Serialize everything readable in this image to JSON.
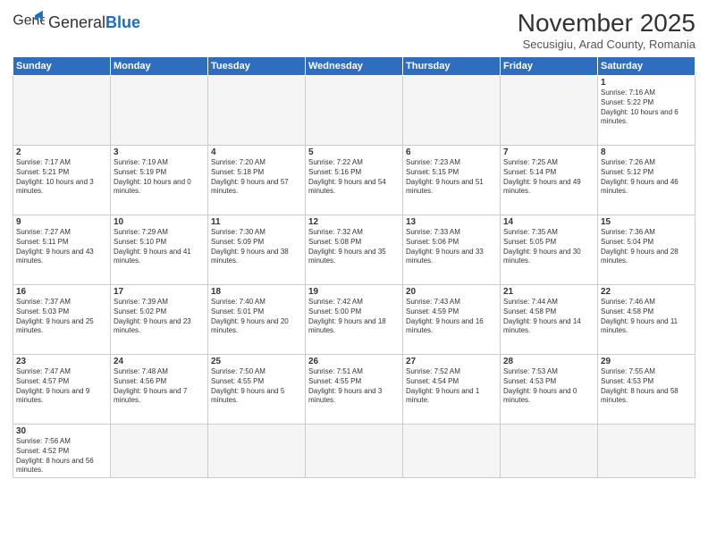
{
  "header": {
    "logo_general": "General",
    "logo_blue": "Blue",
    "month": "November 2025",
    "location": "Secusigiu, Arad County, Romania"
  },
  "weekdays": [
    "Sunday",
    "Monday",
    "Tuesday",
    "Wednesday",
    "Thursday",
    "Friday",
    "Saturday"
  ],
  "weeks": [
    [
      {
        "day": "",
        "info": ""
      },
      {
        "day": "",
        "info": ""
      },
      {
        "day": "",
        "info": ""
      },
      {
        "day": "",
        "info": ""
      },
      {
        "day": "",
        "info": ""
      },
      {
        "day": "",
        "info": ""
      },
      {
        "day": "1",
        "info": "Sunrise: 7:16 AM\nSunset: 5:22 PM\nDaylight: 10 hours and 6 minutes."
      }
    ],
    [
      {
        "day": "2",
        "info": "Sunrise: 7:17 AM\nSunset: 5:21 PM\nDaylight: 10 hours and 3 minutes."
      },
      {
        "day": "3",
        "info": "Sunrise: 7:19 AM\nSunset: 5:19 PM\nDaylight: 10 hours and 0 minutes."
      },
      {
        "day": "4",
        "info": "Sunrise: 7:20 AM\nSunset: 5:18 PM\nDaylight: 9 hours and 57 minutes."
      },
      {
        "day": "5",
        "info": "Sunrise: 7:22 AM\nSunset: 5:16 PM\nDaylight: 9 hours and 54 minutes."
      },
      {
        "day": "6",
        "info": "Sunrise: 7:23 AM\nSunset: 5:15 PM\nDaylight: 9 hours and 51 minutes."
      },
      {
        "day": "7",
        "info": "Sunrise: 7:25 AM\nSunset: 5:14 PM\nDaylight: 9 hours and 49 minutes."
      },
      {
        "day": "8",
        "info": "Sunrise: 7:26 AM\nSunset: 5:12 PM\nDaylight: 9 hours and 46 minutes."
      }
    ],
    [
      {
        "day": "9",
        "info": "Sunrise: 7:27 AM\nSunset: 5:11 PM\nDaylight: 9 hours and 43 minutes."
      },
      {
        "day": "10",
        "info": "Sunrise: 7:29 AM\nSunset: 5:10 PM\nDaylight: 9 hours and 41 minutes."
      },
      {
        "day": "11",
        "info": "Sunrise: 7:30 AM\nSunset: 5:09 PM\nDaylight: 9 hours and 38 minutes."
      },
      {
        "day": "12",
        "info": "Sunrise: 7:32 AM\nSunset: 5:08 PM\nDaylight: 9 hours and 35 minutes."
      },
      {
        "day": "13",
        "info": "Sunrise: 7:33 AM\nSunset: 5:06 PM\nDaylight: 9 hours and 33 minutes."
      },
      {
        "day": "14",
        "info": "Sunrise: 7:35 AM\nSunset: 5:05 PM\nDaylight: 9 hours and 30 minutes."
      },
      {
        "day": "15",
        "info": "Sunrise: 7:36 AM\nSunset: 5:04 PM\nDaylight: 9 hours and 28 minutes."
      }
    ],
    [
      {
        "day": "16",
        "info": "Sunrise: 7:37 AM\nSunset: 5:03 PM\nDaylight: 9 hours and 25 minutes."
      },
      {
        "day": "17",
        "info": "Sunrise: 7:39 AM\nSunset: 5:02 PM\nDaylight: 9 hours and 23 minutes."
      },
      {
        "day": "18",
        "info": "Sunrise: 7:40 AM\nSunset: 5:01 PM\nDaylight: 9 hours and 20 minutes."
      },
      {
        "day": "19",
        "info": "Sunrise: 7:42 AM\nSunset: 5:00 PM\nDaylight: 9 hours and 18 minutes."
      },
      {
        "day": "20",
        "info": "Sunrise: 7:43 AM\nSunset: 4:59 PM\nDaylight: 9 hours and 16 minutes."
      },
      {
        "day": "21",
        "info": "Sunrise: 7:44 AM\nSunset: 4:58 PM\nDaylight: 9 hours and 14 minutes."
      },
      {
        "day": "22",
        "info": "Sunrise: 7:46 AM\nSunset: 4:58 PM\nDaylight: 9 hours and 11 minutes."
      }
    ],
    [
      {
        "day": "23",
        "info": "Sunrise: 7:47 AM\nSunset: 4:57 PM\nDaylight: 9 hours and 9 minutes."
      },
      {
        "day": "24",
        "info": "Sunrise: 7:48 AM\nSunset: 4:56 PM\nDaylight: 9 hours and 7 minutes."
      },
      {
        "day": "25",
        "info": "Sunrise: 7:50 AM\nSunset: 4:55 PM\nDaylight: 9 hours and 5 minutes."
      },
      {
        "day": "26",
        "info": "Sunrise: 7:51 AM\nSunset: 4:55 PM\nDaylight: 9 hours and 3 minutes."
      },
      {
        "day": "27",
        "info": "Sunrise: 7:52 AM\nSunset: 4:54 PM\nDaylight: 9 hours and 1 minute."
      },
      {
        "day": "28",
        "info": "Sunrise: 7:53 AM\nSunset: 4:53 PM\nDaylight: 9 hours and 0 minutes."
      },
      {
        "day": "29",
        "info": "Sunrise: 7:55 AM\nSunset: 4:53 PM\nDaylight: 8 hours and 58 minutes."
      }
    ],
    [
      {
        "day": "30",
        "info": "Sunrise: 7:56 AM\nSunset: 4:52 PM\nDaylight: 8 hours and 56 minutes."
      },
      {
        "day": "",
        "info": ""
      },
      {
        "day": "",
        "info": ""
      },
      {
        "day": "",
        "info": ""
      },
      {
        "day": "",
        "info": ""
      },
      {
        "day": "",
        "info": ""
      },
      {
        "day": "",
        "info": ""
      }
    ]
  ]
}
